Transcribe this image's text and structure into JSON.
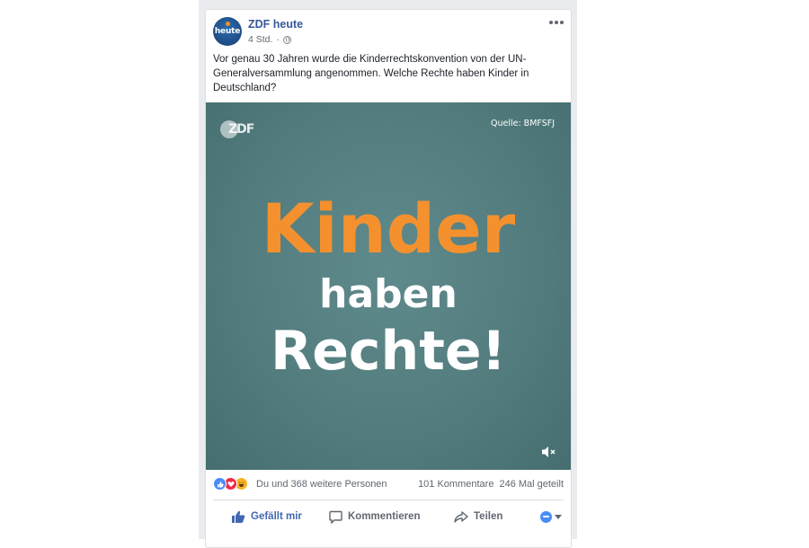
{
  "post": {
    "page_name": "ZDF heute",
    "avatar_text": "heute",
    "timestamp": "4 Std.",
    "privacy_icon": "globe-icon",
    "more_icon": "more-options-icon",
    "text": "Vor genau 30 Jahren wurde die Kinderrechtskonvention von der UN-Generalversammlung angenommen. Welche Rechte haben Kinder in Deutschland?"
  },
  "video": {
    "logo_text": "ZDF",
    "source": "Quelle: BMFSFJ",
    "headline_line1": "Kinder",
    "headline_line2": "haben",
    "headline_line3": "Rechte!",
    "mute_icon": "muted-speaker-icon",
    "colors": {
      "background": "#527b7d",
      "accent": "#f4912e"
    }
  },
  "engagement": {
    "reactions": [
      "like",
      "love",
      "haha"
    ],
    "reactions_text": "Du und 368 weitere Personen",
    "comments": "101 Kommentare",
    "shares": "246 Mal geteilt"
  },
  "actions": {
    "like_label": "Gefällt mir",
    "comment_label": "Kommentieren",
    "share_label": "Teilen"
  },
  "colors": {
    "link_blue": "#365899",
    "like_blue": "#4267b2",
    "feed_background": "#e9ebee"
  }
}
